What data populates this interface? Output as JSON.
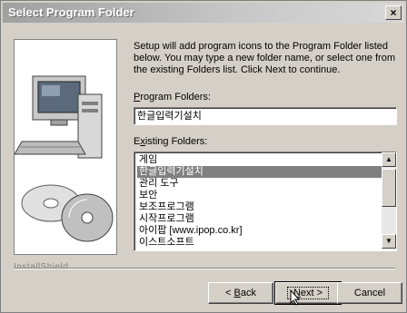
{
  "window": {
    "title": "Select Program Folder"
  },
  "description": "Setup will add program icons to the Program Folder listed below. You may type a new folder name, or select one from the existing Folders list.  Click Next to continue.",
  "program_folders": {
    "label_underline": "P",
    "label_rest": "rogram Folders:",
    "value": "한글입력기설치"
  },
  "existing_folders": {
    "label_prefix": "E",
    "label_underline": "x",
    "label_rest": "isting Folders:",
    "items": [
      "게임",
      "한글입력기설치",
      "관리 도구",
      "보안",
      "보조프로그램",
      "시작프로그램",
      "아이팝 [www.ipop.co.kr]",
      "이스트소프트"
    ],
    "selected_index": 1
  },
  "footer_label": "InstallShield",
  "buttons": {
    "back_underline": "B",
    "back_rest": "ack",
    "back_prefix": "< ",
    "next_underline": "N",
    "next_rest": "ext >",
    "cancel": "Cancel"
  },
  "colors": {
    "face": "#d4d0c8",
    "selection": "#808080"
  },
  "icons": [
    "close-icon",
    "computer-icon",
    "cd-icon",
    "cursor-icon"
  ]
}
